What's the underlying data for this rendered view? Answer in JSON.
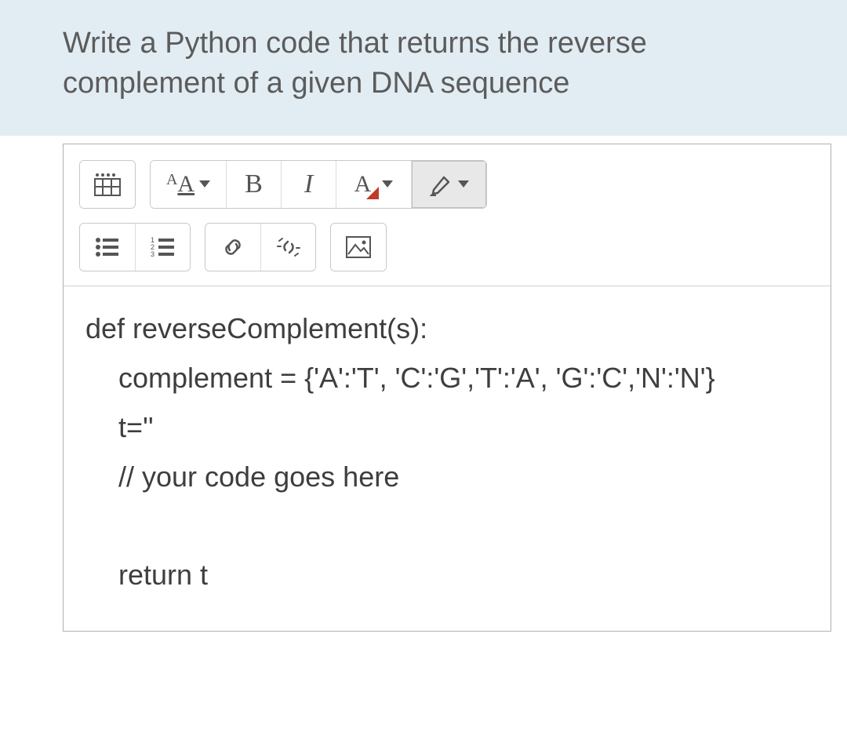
{
  "question": {
    "line1": "Write a Python code that returns the reverse",
    "line2": "complement of a given DNA sequence"
  },
  "toolbar": {
    "table_icon": "table-icon",
    "font_size_icon": "font-size-icon",
    "bold_label": "B",
    "italic_label": "I",
    "text_color_icon": "text-color-icon",
    "highlight_icon": "highlight-icon",
    "ul_icon": "unordered-list-icon",
    "ol_icon": "ordered-list-icon",
    "link_icon": "link-icon",
    "unlink_icon": "unlink-icon",
    "image_icon": "image-icon"
  },
  "code": {
    "line1": "def reverseComplement(s):",
    "line2": "complement = {'A':'T', 'C':'G','T':'A', 'G':'C','N':'N'}",
    "line3": "t=''",
    "line4": "// your code goes here",
    "line5": "return t"
  }
}
